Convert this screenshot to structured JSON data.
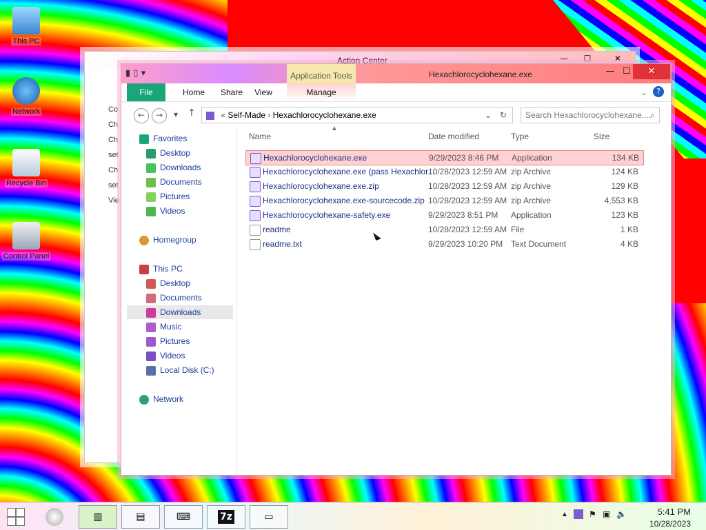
{
  "desktop": {
    "icons": [
      {
        "label": "This PC",
        "icon": "computer-icon"
      },
      {
        "label": "Network",
        "icon": "network-icon"
      },
      {
        "label": "Recycle Bin",
        "icon": "recycle-bin-icon"
      },
      {
        "label": "Control Panel",
        "icon": "control-panel-icon"
      }
    ]
  },
  "action_center": {
    "title": "Action Center",
    "left_snippets": [
      "Co",
      "Ch",
      "Ch",
      "set",
      "Ch",
      "set",
      "Vie"
    ]
  },
  "explorer": {
    "app_tools_label": "Application Tools",
    "title": "Hexachlorocyclohexane.exe",
    "tabs": [
      "File",
      "Home",
      "Share",
      "View",
      "Manage"
    ],
    "address": {
      "path_root": "Self-Made",
      "path_current": "Hexachlorocyclohexane.exe"
    },
    "search_placeholder": "Search Hexachlorocyclohexane....",
    "columns": [
      "Name",
      "Date modified",
      "Type",
      "Size"
    ],
    "files": [
      {
        "name": "Hexachlorocyclohexane.exe",
        "date": "9/29/2023 8:46 PM",
        "type": "Application",
        "size": "134 KB",
        "selected": true
      },
      {
        "name": "Hexachlorocyclohexane.exe (pass Hexachlor...",
        "date": "10/28/2023 12:59 AM",
        "type": "zip Archive",
        "size": "124 KB"
      },
      {
        "name": "Hexachlorocyclohexane.exe.zip",
        "date": "10/28/2023 12:59 AM",
        "type": "zip Archive",
        "size": "129 KB"
      },
      {
        "name": "Hexachlorocyclohexane.exe-sourcecode.zip",
        "date": "10/28/2023 12:59 AM",
        "type": "zip Archive",
        "size": "4,553 KB"
      },
      {
        "name": "Hexachlorocyclohexane-safety.exe",
        "date": "9/29/2023 8:51 PM",
        "type": "Application",
        "size": "123 KB"
      },
      {
        "name": "readme",
        "date": "10/28/2023 12:59 AM",
        "type": "File",
        "size": "1 KB"
      },
      {
        "name": "readme.txt",
        "date": "9/29/2023 10:20 PM",
        "type": "Text Document",
        "size": "4 KB"
      }
    ],
    "nav": {
      "favorites": "Favorites",
      "fav_items": [
        "Desktop",
        "Downloads",
        "Documents",
        "Pictures",
        "Videos"
      ],
      "homegroup": "Homegroup",
      "this_pc": "This PC",
      "pc_items": [
        "Desktop",
        "Documents",
        "Downloads",
        "Music",
        "Pictures",
        "Videos",
        "Local Disk (C:)"
      ],
      "network": "Network"
    }
  },
  "taskbar": {
    "time": "5:41 PM",
    "date": "10/28/2023",
    "apps": [
      "file-explorer-icon",
      "control-panel-icon",
      "keyboard-icon",
      "7zip-icon",
      "display-icon"
    ]
  },
  "colors": {
    "selected_row": "#ffd1d1",
    "file_tab": "#1aa67a",
    "close": "#e3303b"
  }
}
